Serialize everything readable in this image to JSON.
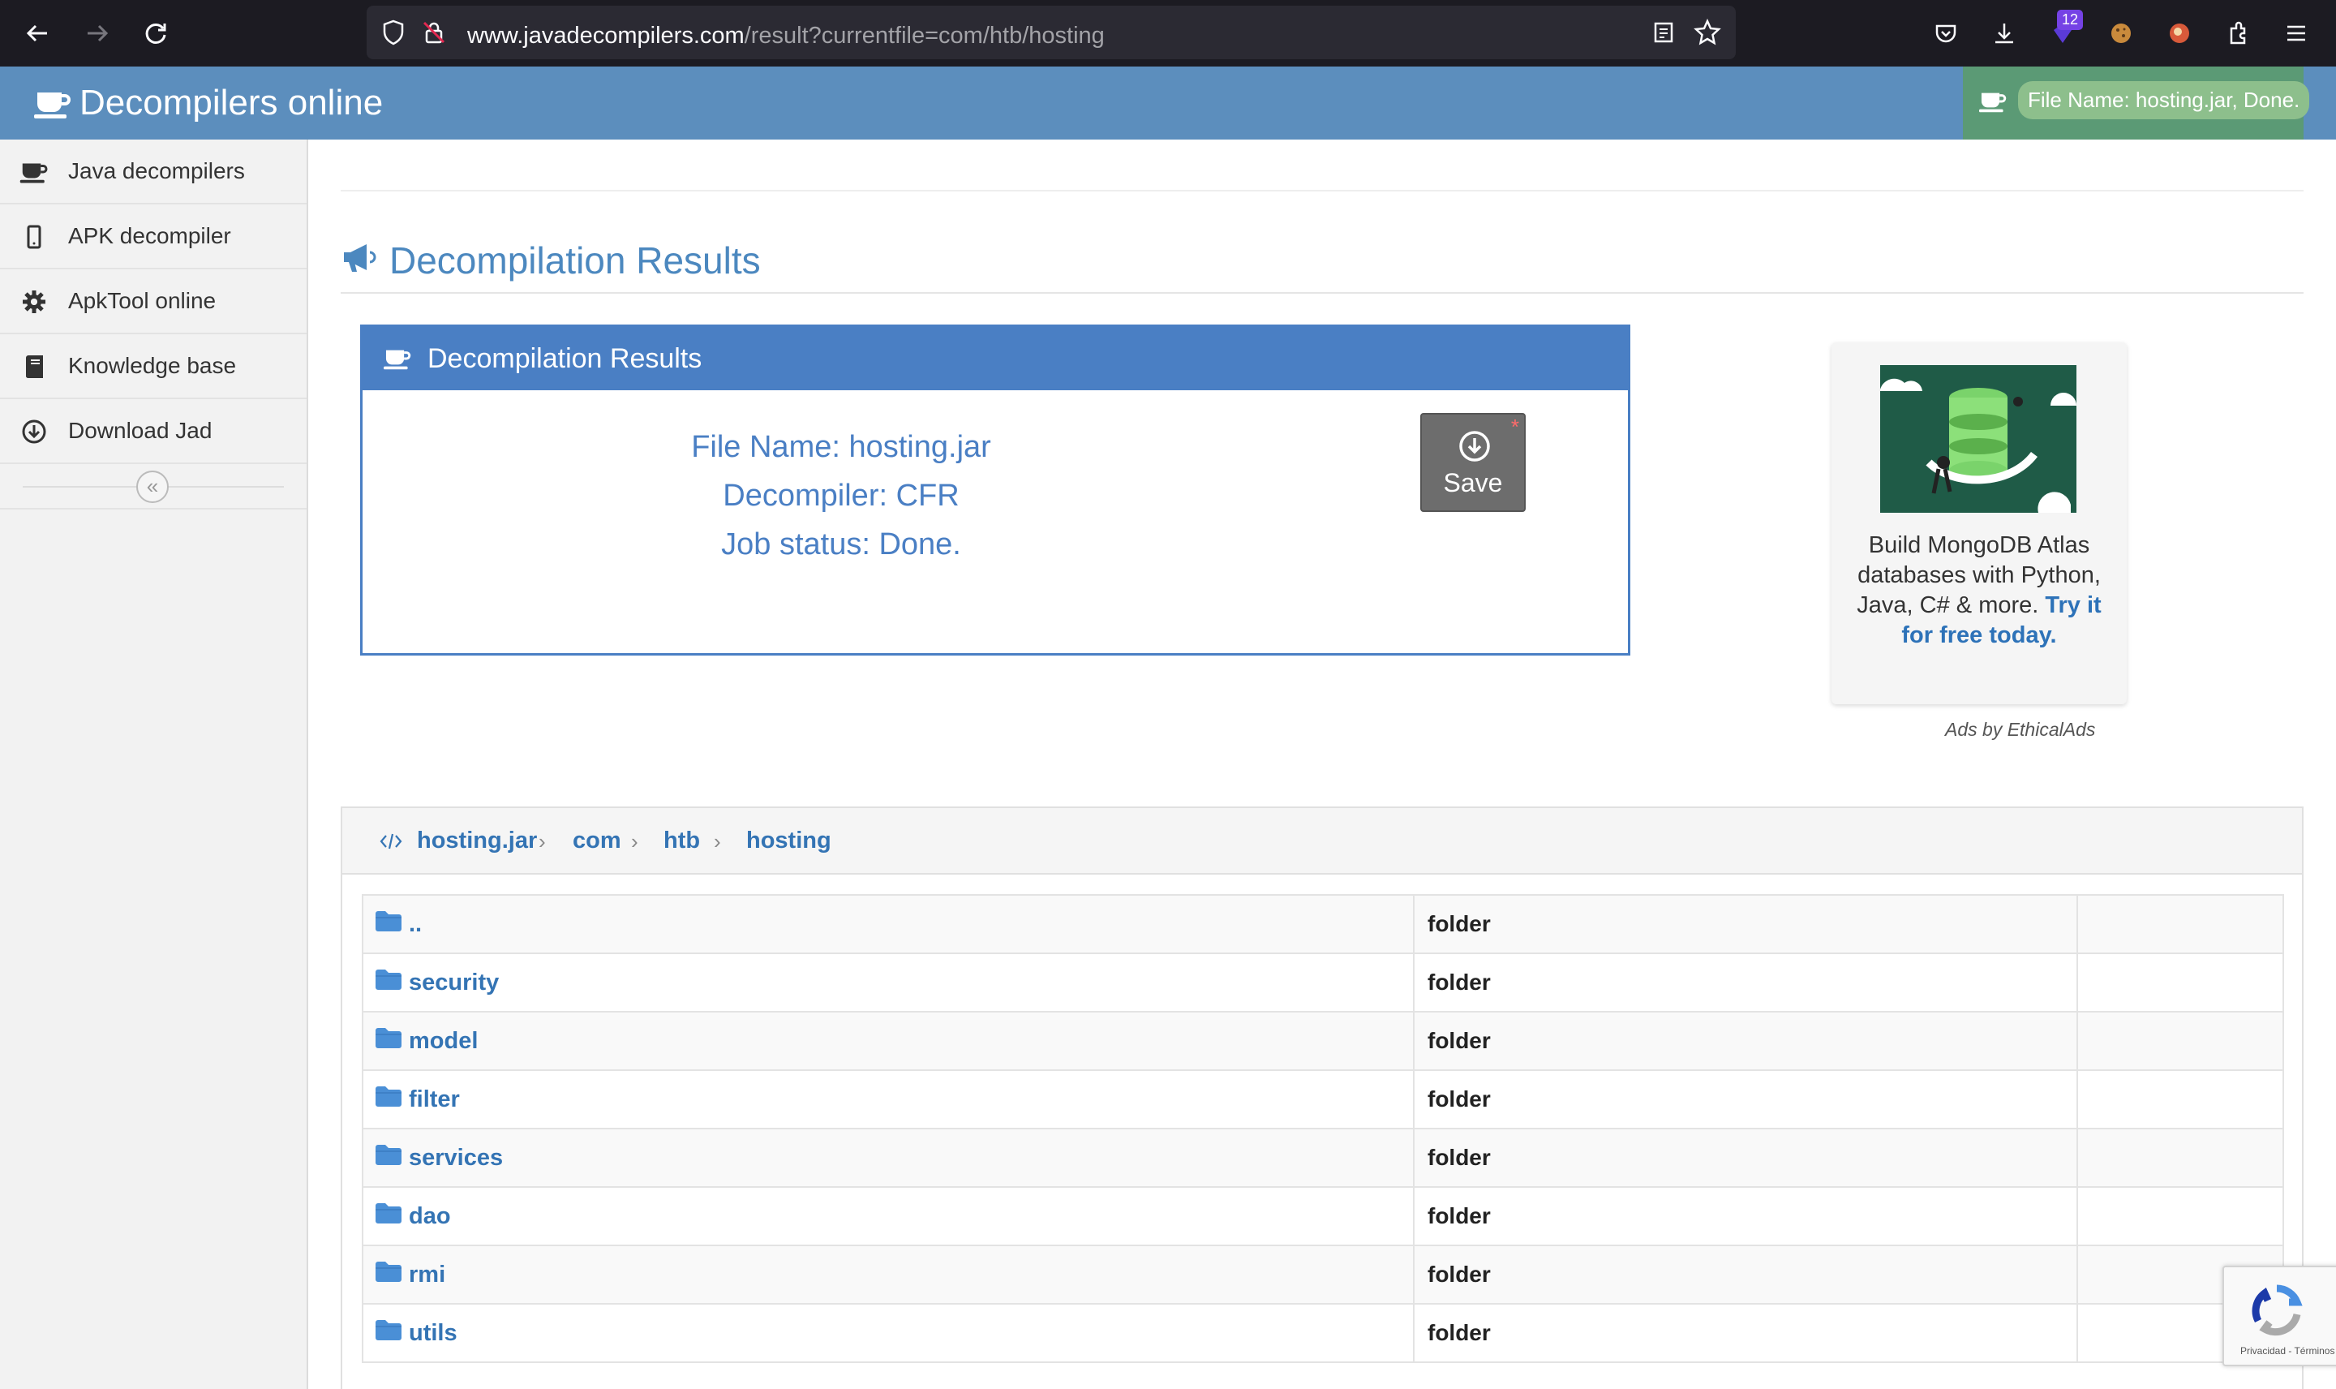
{
  "browser": {
    "url_domain": "www.javadecompilers.com",
    "url_path": "/result?currentfile=com/htb/hosting",
    "extension_badge": "12"
  },
  "header": {
    "title": "Decompilers online",
    "status_text": "File Name: hosting.jar, Done."
  },
  "sidebar": {
    "items": [
      {
        "label": "Java decompilers",
        "icon": "coffee-cup-icon"
      },
      {
        "label": "APK decompiler",
        "icon": "phone-icon"
      },
      {
        "label": "ApkTool online",
        "icon": "gear-icon"
      },
      {
        "label": "Knowledge base",
        "icon": "book-icon"
      },
      {
        "label": "Download Jad",
        "icon": "download-circle-icon"
      }
    ],
    "collapse_symbol": "«"
  },
  "main": {
    "heading": "Decompilation Results",
    "panel": {
      "title": "Decompilation Results",
      "file_name": "File Name: hosting.jar",
      "decompiler": "Decompiler: CFR",
      "job_status": "Job status: Done.",
      "save_label": "Save",
      "save_marker": "*"
    },
    "ad": {
      "text": "Build MongoDB Atlas databases with Python, Java, C# & more.",
      "link_text": "Try it for free today.",
      "attribution": "Ads by EthicalAds"
    },
    "breadcrumb": [
      "hosting.jar",
      "com",
      "htb",
      "hosting"
    ],
    "files": [
      {
        "name": "..",
        "type": "folder"
      },
      {
        "name": "security",
        "type": "folder"
      },
      {
        "name": "model",
        "type": "folder"
      },
      {
        "name": "filter",
        "type": "folder"
      },
      {
        "name": "services",
        "type": "folder"
      },
      {
        "name": "dao",
        "type": "folder"
      },
      {
        "name": "rmi",
        "type": "folder"
      },
      {
        "name": "utils",
        "type": "folder"
      }
    ]
  },
  "recaptcha": {
    "text": "Privacidad - Términos"
  },
  "colors": {
    "header_bg": "#5c8ebd",
    "panel_accent": "#4a7fc4",
    "status_green": "#5b9a75",
    "link_blue": "#3474b4"
  }
}
